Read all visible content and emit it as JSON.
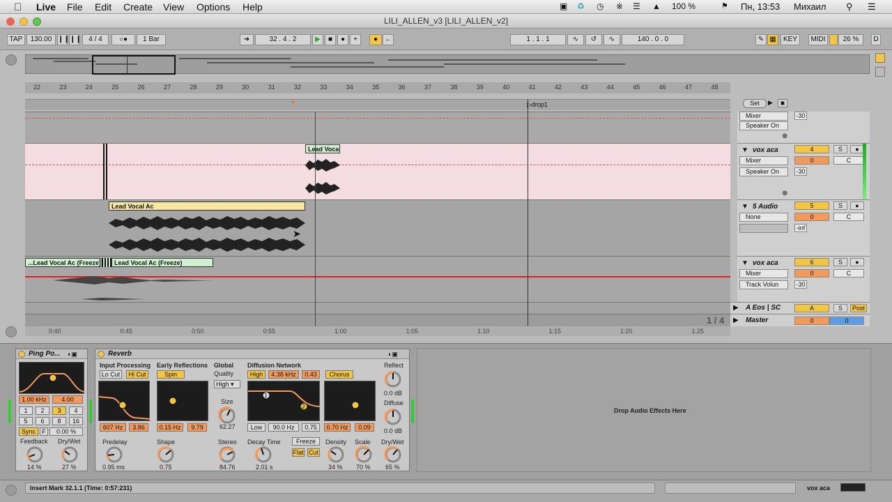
{
  "menubar": {
    "apple": "",
    "app": "Live",
    "items": [
      "File",
      "Edit",
      "Create",
      "View",
      "Options",
      "Help"
    ],
    "battery": "100 %",
    "clock": "Пн, 13:53",
    "user": "Михаил"
  },
  "window": {
    "title": "LILI_ALLEN_v3  [LILI_ALLEN_v2]"
  },
  "transport": {
    "tap": "TAP",
    "tempo": "130.00",
    "signature": "4 / 4",
    "quant": "1 Bar",
    "position": "32 .  4 .  2",
    "loop_start": "1 .  1 .  1",
    "loop_length": "140 .  0 .  0",
    "key": "KEY",
    "midi": "MIDI",
    "cpu": "26 %",
    "d": "D"
  },
  "ruler": {
    "bars": [
      "22",
      "23",
      "24",
      "25",
      "26",
      "27",
      "28",
      "29",
      "30",
      "31",
      "32",
      "33",
      "34",
      "35",
      "36",
      "37",
      "38",
      "39",
      "40",
      "41",
      "42",
      "43",
      "44",
      "45",
      "46",
      "47",
      "48"
    ]
  },
  "locator": {
    "label": "drop1",
    "set": "Set"
  },
  "clips": {
    "clip1": "Lead Vocal",
    "clip2": "Lead Vocal Ac",
    "clip3": "...Lead Vocal Ac (Freeze)",
    "clip4": "Lead Vocal Ac (Freeze)"
  },
  "tracks": [
    {
      "name": "",
      "input": "Mixer",
      "output": "Speaker On",
      "number": "",
      "vol": "-30"
    },
    {
      "name": "vox aca",
      "input": "Mixer",
      "output": "Speaker On",
      "number": "4",
      "vol": "-30",
      "pan": "C",
      "send": "0"
    },
    {
      "name": "5 Audio",
      "input": "None",
      "output": "",
      "number": "5",
      "vol": "-inf",
      "pan": "C",
      "send": "0"
    },
    {
      "name": "vox aca",
      "input": "Mixer",
      "output": "Track Volun",
      "number": "6",
      "vol": "-30",
      "pan": "C",
      "send": "0"
    },
    {
      "name": "A Eos | SC",
      "number": "A",
      "post": "Post"
    },
    {
      "name": "Master",
      "number": "0",
      "value": "0"
    }
  ],
  "pager": "1 / 4",
  "timeline": [
    "0:40",
    "0:45",
    "0:50",
    "0:55",
    "1:00",
    "1:05",
    "1:10",
    "1:15",
    "1:20",
    "1:25"
  ],
  "ping_pong": {
    "title": "Ping Po...",
    "freq": "1.00 kHz",
    "width": "4.00",
    "grid": [
      "1",
      "2",
      "3",
      "4",
      "5",
      "6",
      "8",
      "16"
    ],
    "sync": "Sync",
    "f": "F",
    "offset": "0.00 %",
    "feedback_label": "Feedback",
    "feedback": "14 %",
    "drywet_label": "Dry/Wet",
    "drywet": "27 %"
  },
  "reverb": {
    "title": "Reverb",
    "input_processing": "Input Processing",
    "lo_cut": "Lo Cut",
    "hi_cut": "Hi Cut",
    "early_reflections": "Early Reflections",
    "spin": "Spin",
    "global": "Global",
    "quality": "Quality",
    "quality_val": "High",
    "size_label": "Size",
    "size": "62.27",
    "diffusion_network": "Diffusion Network",
    "high": "High",
    "high_freq": "4.38 kHz",
    "high_q": "0.43",
    "chorus": "Chorus",
    "reflect": "Reflect",
    "reflect_val": "0.0 dB",
    "diffuse": "Diffuse",
    "diffuse_val": "0.0 dB",
    "in_freq": "607 Hz",
    "in_q": "3.86",
    "er_freq": "0.15 Hz",
    "er_amt": "9.79",
    "low": "Low",
    "low_freq": "90.0 Hz",
    "low_q": "0.75",
    "ch_freq": "0.70 Hz",
    "ch_amt": "0.09",
    "predelay_label": "Predelay",
    "predelay": "0.95 ms",
    "shape_label": "Shape",
    "shape": "0.75",
    "stereo_label": "Stereo",
    "stereo": "84.76",
    "decay_label": "Decay Time",
    "decay": "2.01 s",
    "freeze": "Freeze",
    "flat": "Flat",
    "cut": "Cut",
    "density_label": "Density",
    "density": "34 %",
    "scale_label": "Scale",
    "scale": "70 %",
    "drywet_label": "Dry/Wet",
    "drywet": "65 %"
  },
  "drop_zone": "Drop Audio Effects Here",
  "status": {
    "text": "Insert Mark 32.1.1 (Time: 0:57:231)",
    "track": "vox aca"
  },
  "colors": {
    "accent": "#f3c640",
    "orange": "#f49a58",
    "clip_green": "#cfefcf",
    "clip_yellow": "#f8e7a0",
    "record_red": "#e02020"
  }
}
